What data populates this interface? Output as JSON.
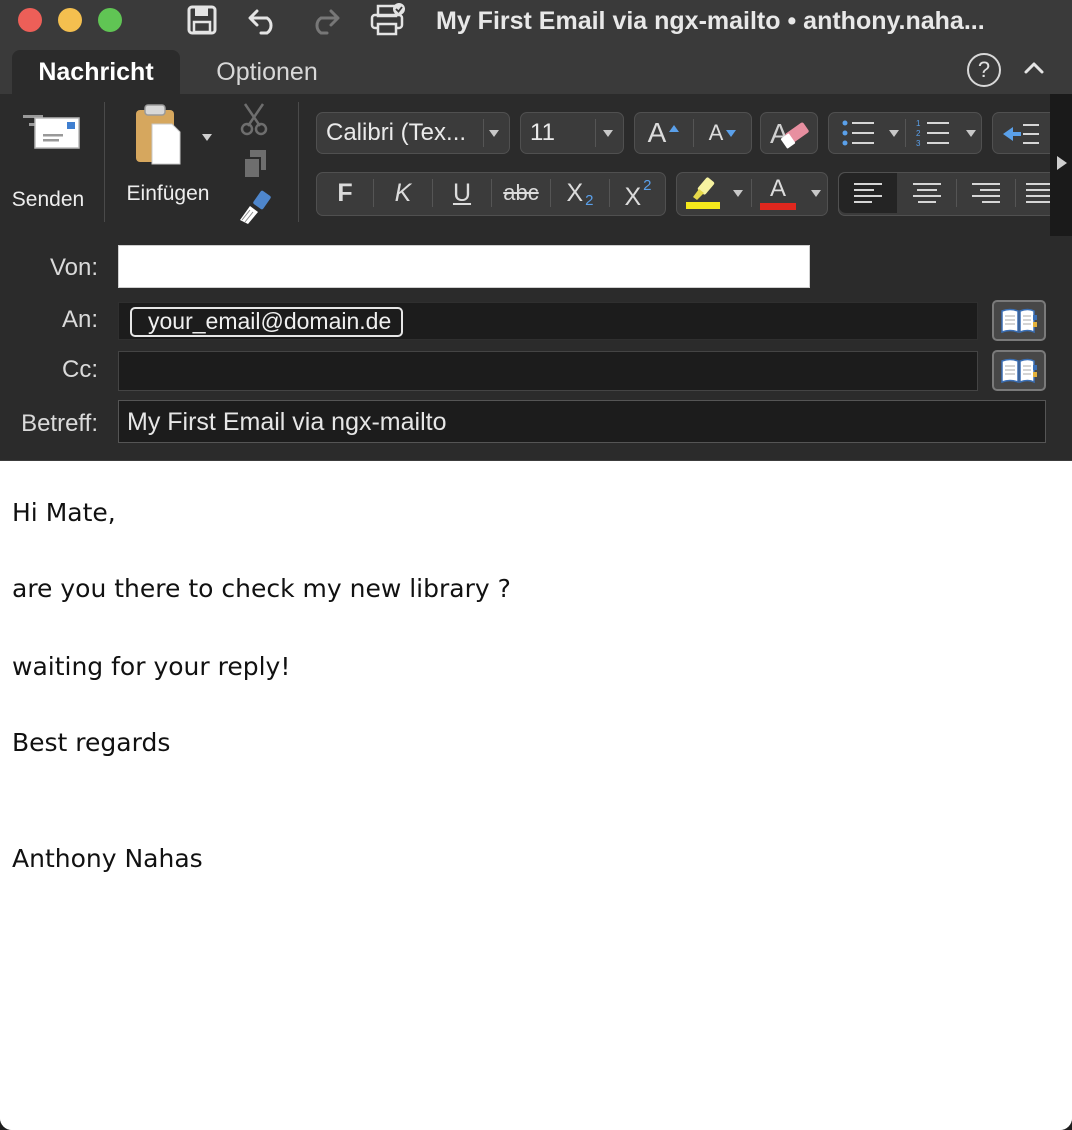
{
  "window": {
    "title": "My First Email via ngx-mailto • anthony.naha..."
  },
  "tabs": [
    {
      "label": "Nachricht",
      "active": true
    },
    {
      "label": "Optionen",
      "active": false
    }
  ],
  "help": {
    "label": "?"
  },
  "ribbon": {
    "send_label": "Senden",
    "paste_label": "Einfügen",
    "font_name": "Calibri (Tex...",
    "font_size": "11",
    "bold": "F",
    "italic": "K",
    "underline": "U",
    "strike": "abc",
    "subscript_base": "X",
    "subscript_mark": "2",
    "superscript_base": "X",
    "superscript_mark": "2",
    "grow_font": "A",
    "shrink_font": "A",
    "font_color_letter": "A",
    "highlight_color": "#f5e81c",
    "font_color": "#e0271e"
  },
  "header": {
    "from_label": "Von:",
    "to_label": "An:",
    "cc_label": "Cc:",
    "subject_label": "Betreff:",
    "from_value": "",
    "to_recipient": "your_email@domain.de",
    "cc_value": "",
    "subject_value": "My First Email via ngx-mailto"
  },
  "body": {
    "lines": [
      "Hi Mate,",
      "are you there to check my new library ?",
      "waiting for your reply!",
      "Best regards",
      "Anthony Nahas"
    ]
  }
}
